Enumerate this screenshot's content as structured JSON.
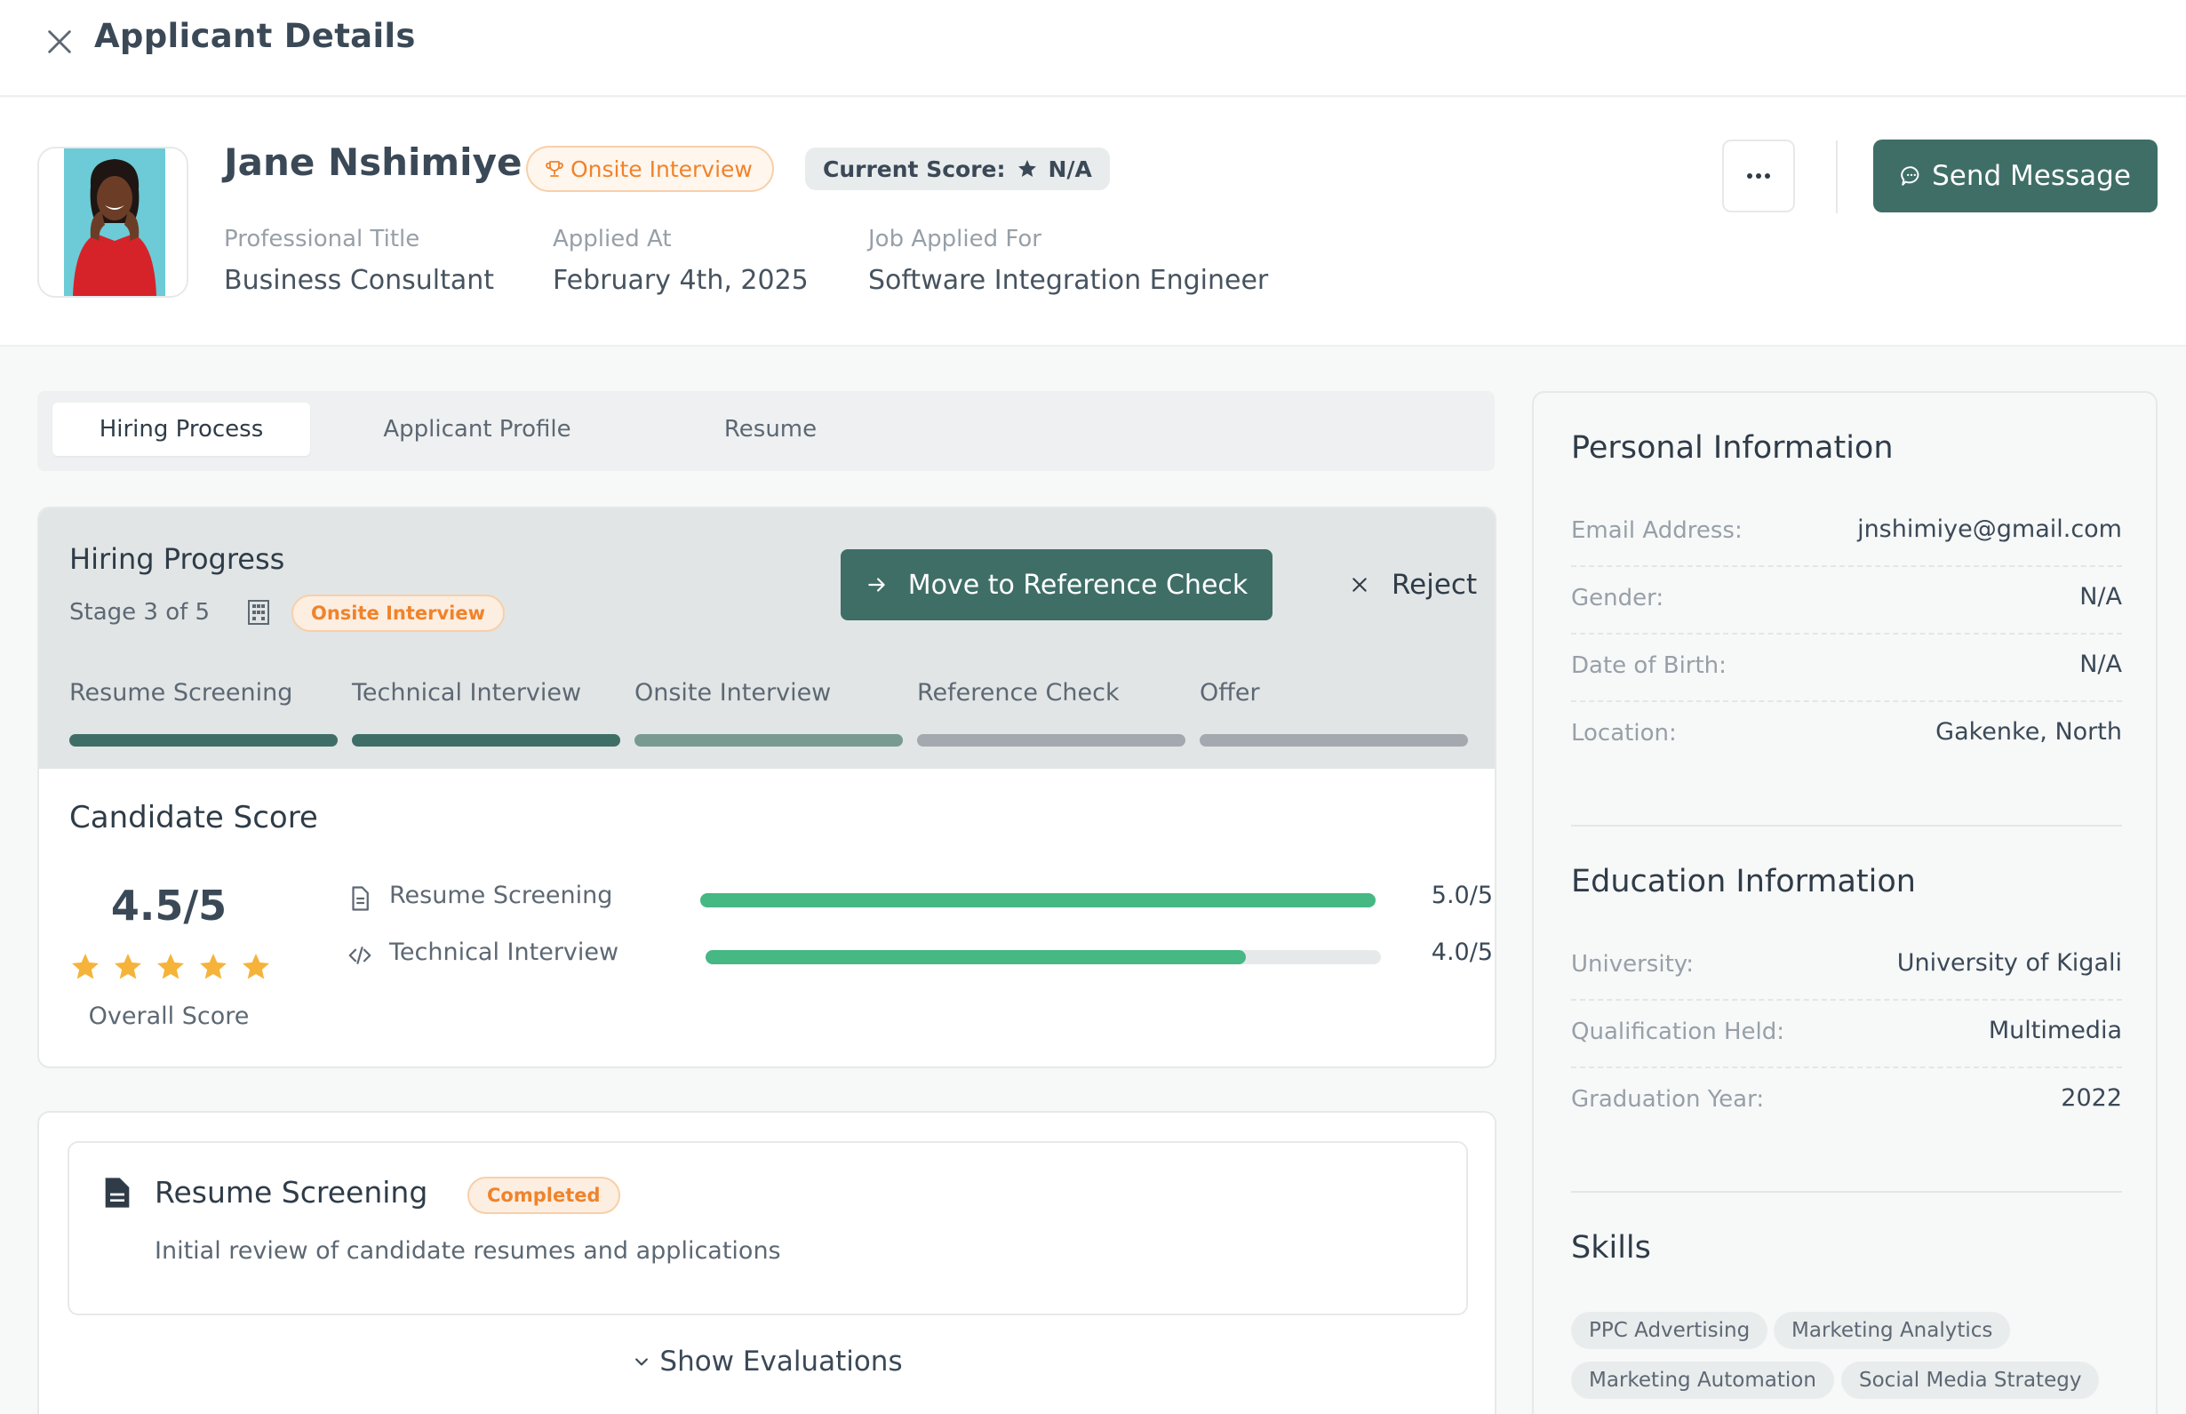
{
  "topbar": {
    "title": "Applicant Details"
  },
  "applicant": {
    "name": "Jane Nshimiye",
    "stage_badge": "Onsite Interview",
    "score_label": "Current Score:",
    "score_value": "N/A",
    "meta": [
      {
        "label": "Professional Title",
        "value": "Business Consultant"
      },
      {
        "label": "Applied At",
        "value": "February 4th, 2025"
      },
      {
        "label": "Job Applied For",
        "value": "Software Integration Engineer"
      }
    ],
    "more_label": "...",
    "send_message_label": "Send Message"
  },
  "tabs": [
    "Hiring Process",
    "Applicant Profile",
    "Resume"
  ],
  "active_tab": "Hiring Process",
  "hiring": {
    "title": "Hiring Progress",
    "stage_text": "Stage 3 of 5",
    "stage_badge": "Onsite Interview",
    "move_label": "Move to Reference Check",
    "reject_label": "Reject",
    "stages": [
      {
        "label": "Resume Screening",
        "status": "completed"
      },
      {
        "label": "Technical Interview",
        "status": "completed"
      },
      {
        "label": "Onsite Interview",
        "status": "current"
      },
      {
        "label": "Reference Check",
        "status": "pending"
      },
      {
        "label": "Offer",
        "status": "pending"
      }
    ],
    "status_colors": {
      "completed": "#3f6e67",
      "current": "#789a91",
      "pending": "#a3a9ae"
    }
  },
  "candidate_score": {
    "title": "Candidate Score",
    "overall": "4.5/5",
    "overall_label": "Overall Score",
    "stars": 5,
    "rows": [
      {
        "icon": "document-icon",
        "label": "Resume Screening",
        "value": "5.0/5",
        "fraction": 1.0
      },
      {
        "icon": "code-icon",
        "label": "Technical Interview",
        "value": "4.0/5",
        "fraction": 0.8
      }
    ]
  },
  "stage_detail": {
    "title": "Resume Screening",
    "badge": "Completed",
    "description": "Initial review of candidate resumes and applications",
    "show_evaluations": "Show Evaluations"
  },
  "sidebar": {
    "personal": {
      "title": "Personal Information",
      "rows": [
        {
          "label": "Email Address:",
          "value": "jnshimiye@gmail.com"
        },
        {
          "label": "Gender:",
          "value": "N/A"
        },
        {
          "label": "Date of Birth:",
          "value": "N/A"
        },
        {
          "label": "Location:",
          "value": "Gakenke, North"
        }
      ]
    },
    "education": {
      "title": "Education Information",
      "rows": [
        {
          "label": "University:",
          "value": "University of Kigali"
        },
        {
          "label": "Qualification Held:",
          "value": "Multimedia"
        },
        {
          "label": "Graduation Year:",
          "value": "2022"
        }
      ]
    },
    "skills": {
      "title": "Skills",
      "items": [
        "PPC Advertising",
        "Marketing Analytics",
        "Marketing Automation",
        "Social Media Strategy"
      ]
    }
  },
  "colors": {
    "primary": "#3f6e67",
    "accent_orange": "#f0832a",
    "star": "#f6b33a",
    "score_green": "#45b883"
  }
}
